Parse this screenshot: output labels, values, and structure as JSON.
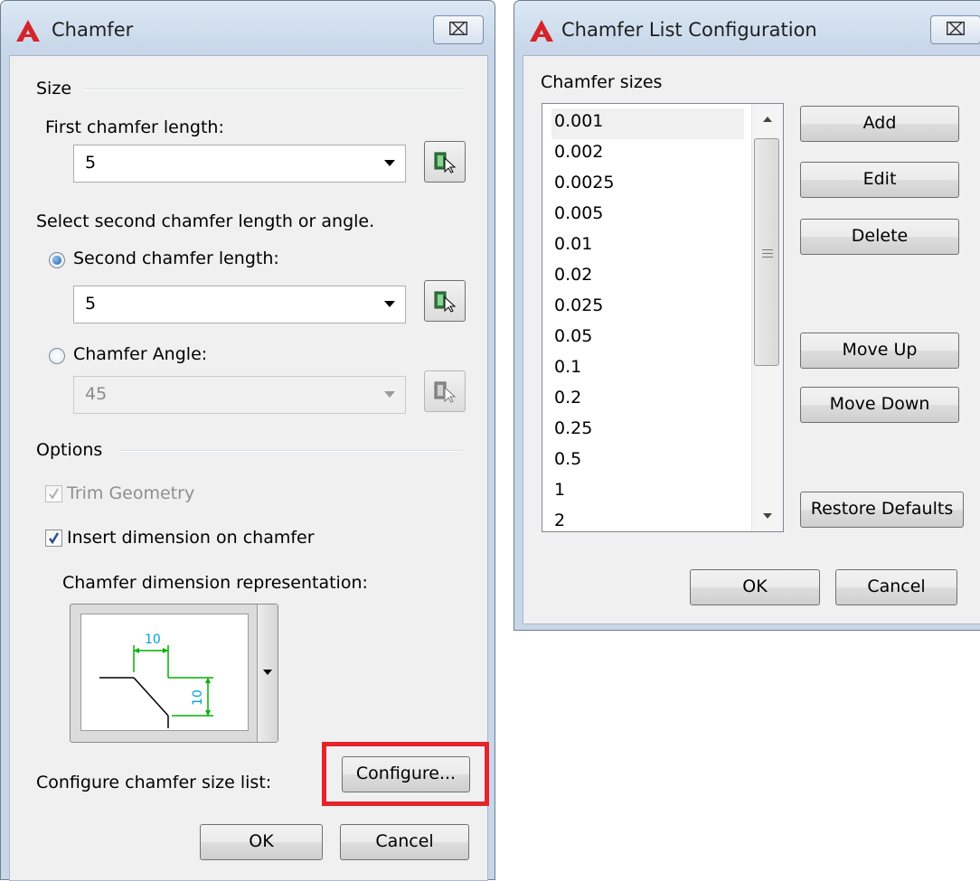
{
  "chamfer_dialog": {
    "title": "Chamfer",
    "close_glyph": "⌧",
    "size_group": "Size",
    "first_length_label": "First chamfer length:",
    "first_length_value": "5",
    "select_prompt": "Select second chamfer length or angle.",
    "second_length_label": "Second chamfer length:",
    "second_length_value": "5",
    "angle_label": "Chamfer Angle:",
    "angle_value": "45",
    "options_group": "Options",
    "trim_label": "Trim Geometry",
    "insert_dim_label": "Insert dimension on chamfer",
    "dim_repr_label": "Chamfer dimension representation:",
    "dim_preview_labels": [
      "10",
      "10"
    ],
    "configure_label": "Configure chamfer size list:",
    "configure_button": "Configure...",
    "ok_button": "OK",
    "cancel_button": "Cancel",
    "second_length_selected": true,
    "trim_checked": true,
    "trim_enabled": false,
    "insert_dim_checked": true
  },
  "list_dialog": {
    "title": "Chamfer List Configuration",
    "close_glyph": "⌧",
    "sizes_label": "Chamfer sizes",
    "sizes": [
      "0.001",
      "0.002",
      "0.0025",
      "0.005",
      "0.01",
      "0.02",
      "0.025",
      "0.05",
      "0.1",
      "0.2",
      "0.25",
      "0.5",
      "1",
      "2"
    ],
    "selected_index": 0,
    "add_button": "Add",
    "edit_button": "Edit",
    "delete_button": "Delete",
    "move_up_button": "Move Up",
    "move_down_button": "Move Down",
    "restore_button": "Restore Defaults",
    "ok_button": "OK",
    "cancel_button": "Cancel"
  },
  "colors": {
    "highlight": "#e3252b",
    "dimension_green": "#00b000",
    "dimension_text": "#00a0e0"
  },
  "icons": {
    "app": "autocad-logo-icon",
    "close": "close-icon",
    "pick": "select-object-icon"
  }
}
